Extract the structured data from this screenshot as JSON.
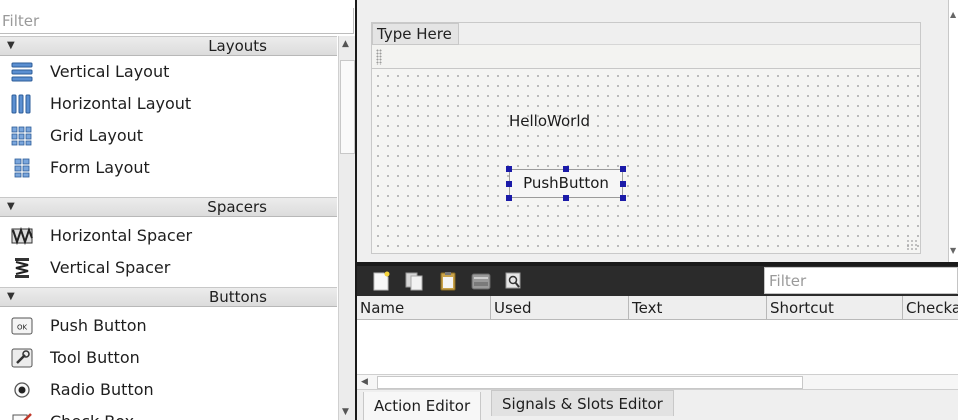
{
  "widget_box": {
    "filter_placeholder": "Filter",
    "categories": [
      {
        "label": "Layouts",
        "items": [
          {
            "label": "Vertical Layout",
            "icon": "vertical-layout-icon"
          },
          {
            "label": "Horizontal Layout",
            "icon": "horizontal-layout-icon"
          },
          {
            "label": "Grid Layout",
            "icon": "grid-layout-icon"
          },
          {
            "label": "Form Layout",
            "icon": "form-layout-icon"
          }
        ]
      },
      {
        "label": "Spacers",
        "items": [
          {
            "label": "Horizontal Spacer",
            "icon": "horizontal-spacer-icon"
          },
          {
            "label": "Vertical Spacer",
            "icon": "vertical-spacer-icon"
          }
        ]
      },
      {
        "label": "Buttons",
        "items": [
          {
            "label": "Push Button",
            "icon": "push-button-icon"
          },
          {
            "label": "Tool Button",
            "icon": "tool-button-icon"
          },
          {
            "label": "Radio Button",
            "icon": "radio-button-icon"
          },
          {
            "label": "Check Box",
            "icon": "check-box-icon"
          }
        ]
      }
    ]
  },
  "form": {
    "menu_placeholder": "Type Here",
    "label_text": "HelloWorld",
    "button_text": "PushButton"
  },
  "action_editor": {
    "filter_placeholder": "Filter",
    "columns": [
      "Name",
      "Used",
      "Text",
      "Shortcut",
      "Checkable"
    ],
    "toolbar_icons": [
      "new-action-icon",
      "copy-action-icon",
      "paste-action-icon",
      "delete-action-icon",
      "configure-icon"
    ],
    "tabs": [
      "Action Editor",
      "Signals & Slots Editor"
    ],
    "active_tab": "Action Editor"
  },
  "colors": {
    "selection_handle": "#1a1aa8",
    "toolbar_bg": "#2b2b2b",
    "splitter": "#1a1a1a"
  }
}
